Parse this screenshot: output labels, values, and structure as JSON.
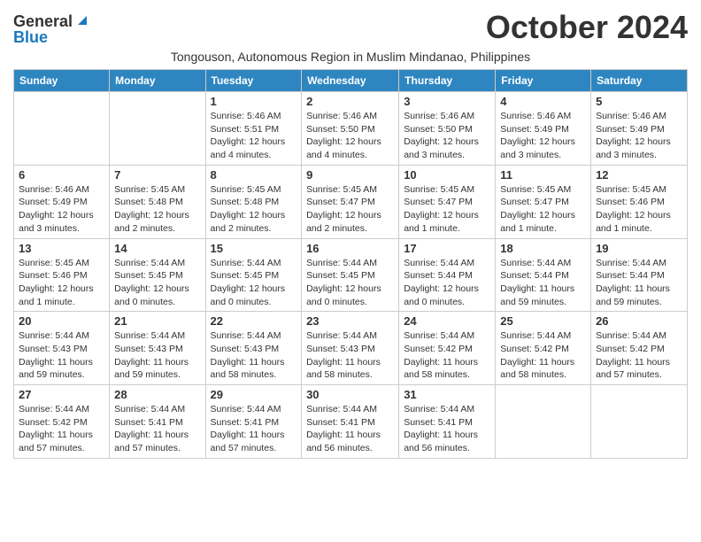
{
  "header": {
    "logo_general": "General",
    "logo_blue": "Blue",
    "month_title": "October 2024",
    "subtitle": "Tongouson, Autonomous Region in Muslim Mindanao, Philippines"
  },
  "weekdays": [
    "Sunday",
    "Monday",
    "Tuesday",
    "Wednesday",
    "Thursday",
    "Friday",
    "Saturday"
  ],
  "weeks": [
    [
      {
        "day": "",
        "info": ""
      },
      {
        "day": "",
        "info": ""
      },
      {
        "day": "1",
        "info": "Sunrise: 5:46 AM\nSunset: 5:51 PM\nDaylight: 12 hours and 4 minutes."
      },
      {
        "day": "2",
        "info": "Sunrise: 5:46 AM\nSunset: 5:50 PM\nDaylight: 12 hours and 4 minutes."
      },
      {
        "day": "3",
        "info": "Sunrise: 5:46 AM\nSunset: 5:50 PM\nDaylight: 12 hours and 3 minutes."
      },
      {
        "day": "4",
        "info": "Sunrise: 5:46 AM\nSunset: 5:49 PM\nDaylight: 12 hours and 3 minutes."
      },
      {
        "day": "5",
        "info": "Sunrise: 5:46 AM\nSunset: 5:49 PM\nDaylight: 12 hours and 3 minutes."
      }
    ],
    [
      {
        "day": "6",
        "info": "Sunrise: 5:46 AM\nSunset: 5:49 PM\nDaylight: 12 hours and 3 minutes."
      },
      {
        "day": "7",
        "info": "Sunrise: 5:45 AM\nSunset: 5:48 PM\nDaylight: 12 hours and 2 minutes."
      },
      {
        "day": "8",
        "info": "Sunrise: 5:45 AM\nSunset: 5:48 PM\nDaylight: 12 hours and 2 minutes."
      },
      {
        "day": "9",
        "info": "Sunrise: 5:45 AM\nSunset: 5:47 PM\nDaylight: 12 hours and 2 minutes."
      },
      {
        "day": "10",
        "info": "Sunrise: 5:45 AM\nSunset: 5:47 PM\nDaylight: 12 hours and 1 minute."
      },
      {
        "day": "11",
        "info": "Sunrise: 5:45 AM\nSunset: 5:47 PM\nDaylight: 12 hours and 1 minute."
      },
      {
        "day": "12",
        "info": "Sunrise: 5:45 AM\nSunset: 5:46 PM\nDaylight: 12 hours and 1 minute."
      }
    ],
    [
      {
        "day": "13",
        "info": "Sunrise: 5:45 AM\nSunset: 5:46 PM\nDaylight: 12 hours and 1 minute."
      },
      {
        "day": "14",
        "info": "Sunrise: 5:44 AM\nSunset: 5:45 PM\nDaylight: 12 hours and 0 minutes."
      },
      {
        "day": "15",
        "info": "Sunrise: 5:44 AM\nSunset: 5:45 PM\nDaylight: 12 hours and 0 minutes."
      },
      {
        "day": "16",
        "info": "Sunrise: 5:44 AM\nSunset: 5:45 PM\nDaylight: 12 hours and 0 minutes."
      },
      {
        "day": "17",
        "info": "Sunrise: 5:44 AM\nSunset: 5:44 PM\nDaylight: 12 hours and 0 minutes."
      },
      {
        "day": "18",
        "info": "Sunrise: 5:44 AM\nSunset: 5:44 PM\nDaylight: 11 hours and 59 minutes."
      },
      {
        "day": "19",
        "info": "Sunrise: 5:44 AM\nSunset: 5:44 PM\nDaylight: 11 hours and 59 minutes."
      }
    ],
    [
      {
        "day": "20",
        "info": "Sunrise: 5:44 AM\nSunset: 5:43 PM\nDaylight: 11 hours and 59 minutes."
      },
      {
        "day": "21",
        "info": "Sunrise: 5:44 AM\nSunset: 5:43 PM\nDaylight: 11 hours and 59 minutes."
      },
      {
        "day": "22",
        "info": "Sunrise: 5:44 AM\nSunset: 5:43 PM\nDaylight: 11 hours and 58 minutes."
      },
      {
        "day": "23",
        "info": "Sunrise: 5:44 AM\nSunset: 5:43 PM\nDaylight: 11 hours and 58 minutes."
      },
      {
        "day": "24",
        "info": "Sunrise: 5:44 AM\nSunset: 5:42 PM\nDaylight: 11 hours and 58 minutes."
      },
      {
        "day": "25",
        "info": "Sunrise: 5:44 AM\nSunset: 5:42 PM\nDaylight: 11 hours and 58 minutes."
      },
      {
        "day": "26",
        "info": "Sunrise: 5:44 AM\nSunset: 5:42 PM\nDaylight: 11 hours and 57 minutes."
      }
    ],
    [
      {
        "day": "27",
        "info": "Sunrise: 5:44 AM\nSunset: 5:42 PM\nDaylight: 11 hours and 57 minutes."
      },
      {
        "day": "28",
        "info": "Sunrise: 5:44 AM\nSunset: 5:41 PM\nDaylight: 11 hours and 57 minutes."
      },
      {
        "day": "29",
        "info": "Sunrise: 5:44 AM\nSunset: 5:41 PM\nDaylight: 11 hours and 57 minutes."
      },
      {
        "day": "30",
        "info": "Sunrise: 5:44 AM\nSunset: 5:41 PM\nDaylight: 11 hours and 56 minutes."
      },
      {
        "day": "31",
        "info": "Sunrise: 5:44 AM\nSunset: 5:41 PM\nDaylight: 11 hours and 56 minutes."
      },
      {
        "day": "",
        "info": ""
      },
      {
        "day": "",
        "info": ""
      }
    ]
  ]
}
